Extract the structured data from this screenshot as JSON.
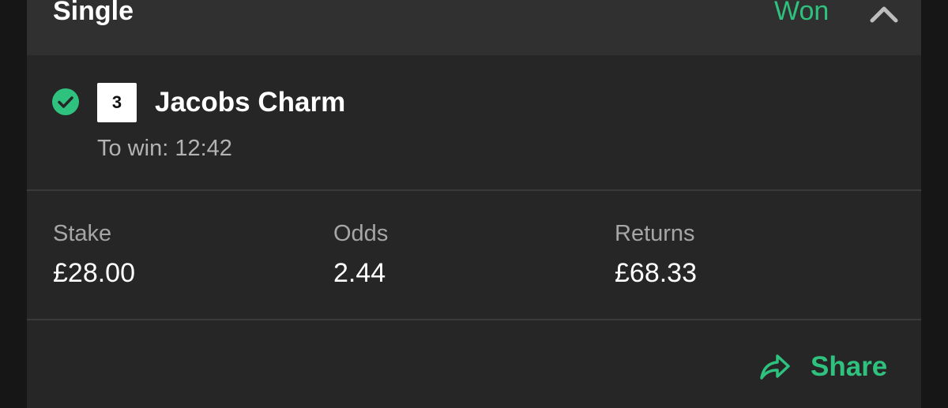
{
  "bet": {
    "type": "Single",
    "status": "Won"
  },
  "selection": {
    "number": "3",
    "name": "Jacobs Charm",
    "market": "To win: 12:42"
  },
  "stats": [
    {
      "label": "Stake",
      "value": "£28.00"
    },
    {
      "label": "Odds",
      "value": "2.44"
    },
    {
      "label": "Returns",
      "value": "£68.33"
    }
  ],
  "actions": {
    "share_label": "Share"
  },
  "colors": {
    "accent": "#2ec27e",
    "card_bg": "#262626",
    "header_bg": "#303030",
    "page_bg": "#161616"
  },
  "icons": {
    "collapse": "chevron-up-icon",
    "won": "check-circle-icon",
    "share": "share-arrow-icon"
  }
}
